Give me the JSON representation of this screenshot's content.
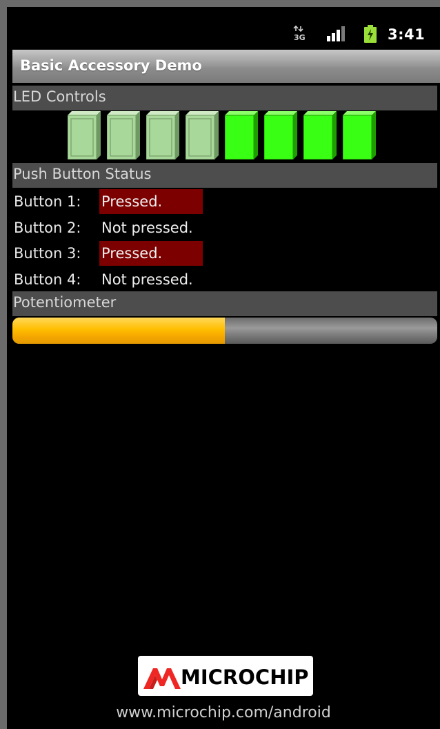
{
  "statusbar": {
    "network_icon": "3g-data-icon",
    "signal_icon": "signal-strength-icon",
    "battery_icon": "battery-charging-icon",
    "time": "3:41",
    "network_label": "3G"
  },
  "app": {
    "title": "Basic Accessory Demo"
  },
  "leds": {
    "title": "LED Controls",
    "states": [
      false,
      false,
      false,
      false,
      true,
      true,
      true,
      true
    ],
    "on_color": "#39ff14",
    "off_color": "#a9d99a"
  },
  "buttons": {
    "title": "Push Button Status",
    "items": [
      {
        "label": "Button 1:",
        "status": "Pressed.",
        "pressed": true
      },
      {
        "label": "Button 2:",
        "status": "Not pressed.",
        "pressed": false
      },
      {
        "label": "Button 3:",
        "status": "Pressed.",
        "pressed": true
      },
      {
        "label": "Button 4:",
        "status": "Not pressed.",
        "pressed": false
      }
    ]
  },
  "potentiometer": {
    "title": "Potentiometer",
    "value": 0.5,
    "fill_color": "#ffbe00"
  },
  "footer": {
    "logo_text": "MICROCHIP",
    "url": "www.microchip.com/android"
  }
}
